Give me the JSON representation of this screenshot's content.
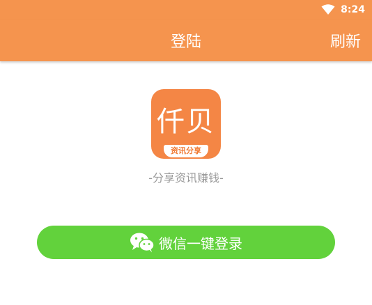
{
  "status_bar": {
    "time": "8:24",
    "wifi_icon": "wifi-icon"
  },
  "toolbar": {
    "title": "登陆",
    "refresh_label": "刷新",
    "background": "#f5944e"
  },
  "logo": {
    "main_text": "仟贝",
    "banner_text": "资讯分享",
    "color": "#f48645"
  },
  "slogan": "-分享资讯赚钱-",
  "login_button": {
    "label": "微信一键登录",
    "icon": "wechat-icon",
    "color": "#62d23c"
  }
}
